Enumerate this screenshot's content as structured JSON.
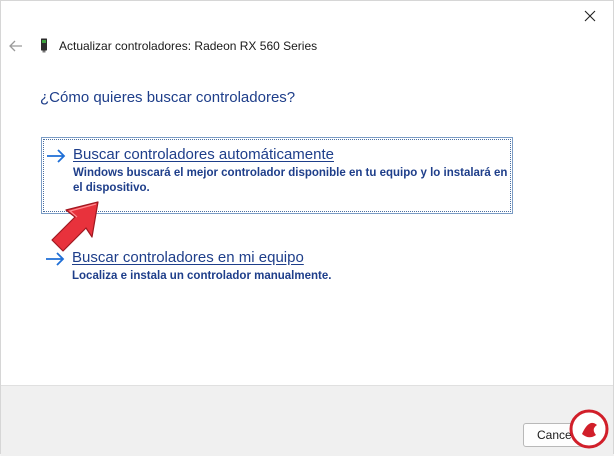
{
  "window": {
    "title": "Actualizar controladores: Radeon RX 560 Series",
    "close_icon": "close-icon",
    "back_icon": "back-arrow-icon",
    "device_icon": "graphics-card-icon"
  },
  "main": {
    "heading": "¿Cómo quieres buscar controladores?",
    "options": [
      {
        "title": "Buscar controladores automáticamente",
        "description": "Windows buscará el mejor controlador disponible en tu equipo y lo instalará en el dispositivo.",
        "icon": "arrow-right-icon",
        "selected": true
      },
      {
        "title": "Buscar controladores en mi equipo",
        "description": "Localiza e instala un controlador manualmente.",
        "icon": "arrow-right-icon",
        "selected": false
      }
    ]
  },
  "footer": {
    "cancel_label": "Cancelar"
  },
  "colors": {
    "link_blue": "#1e3e8a",
    "arrow_blue": "#1f6fd6",
    "pointer_red": "#e8323c"
  }
}
